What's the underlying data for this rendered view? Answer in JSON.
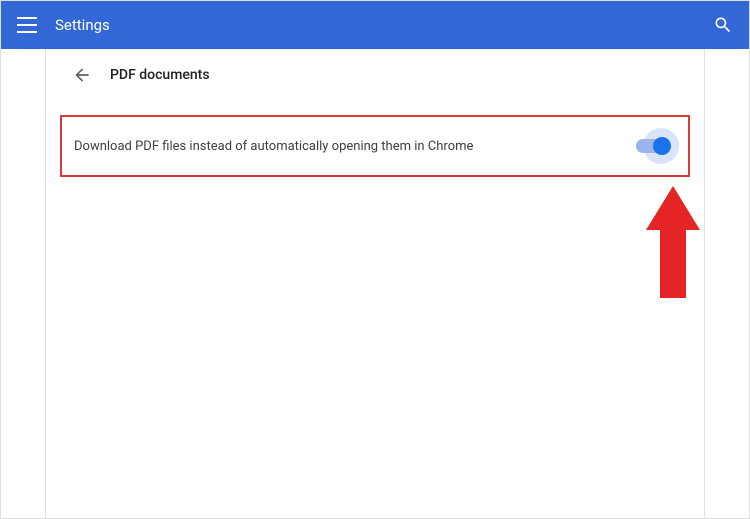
{
  "header": {
    "title": "Settings"
  },
  "page": {
    "title": "PDF documents"
  },
  "setting": {
    "download_pdf_label": "Download PDF files instead of automatically opening them in Chrome",
    "toggle_on": true
  },
  "colors": {
    "header_bg": "#3367d6",
    "toggle_on_thumb": "#1a73e8",
    "highlight_border": "#dd3a3a",
    "annotation_arrow": "#e52525"
  }
}
